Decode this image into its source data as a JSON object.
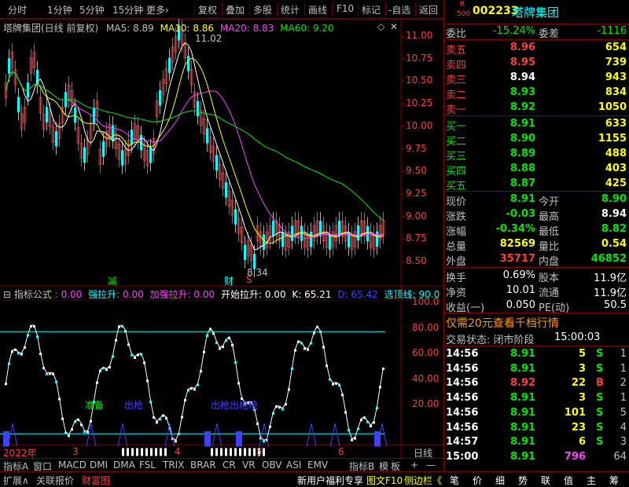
{
  "toolbar": {
    "items": [
      "分时",
      "1分钟",
      "5分钟",
      "15分钟",
      "更多›",
      "复权",
      "叠加",
      "多股",
      "统计",
      "画线",
      "F10",
      "标记",
      "-自选",
      "返回"
    ]
  },
  "chart_header": {
    "name": "塔牌集团(日线 前复权)",
    "ma5": "MA5: 8.89",
    "ma10": "MA10: 8.86",
    "ma20": "MA20: 8.83",
    "ma60": "MA60: 9.20"
  },
  "price_axis": [
    "11.00",
    "10.75",
    "10.50",
    "10.25",
    "10.00",
    "9.75",
    "9.50",
    "9.25",
    "9.00",
    "8.75",
    "8.50"
  ],
  "price_marks": {
    "high": "11.02",
    "low": "8.34",
    "jian": "减",
    "cai": "财",
    "s": "S"
  },
  "indicator_header": {
    "name": "指标公式",
    "v1": ": 0.00",
    "l2": "强拉升",
    "v2": ": 0.00",
    "l3": "加强拉升",
    "v3": ": 0.00",
    "l4": "开始拉升",
    "v4": ": 0.00",
    "l5": "K",
    "v5": ": 65.21",
    "l6": "D",
    "v6": ": 65.42",
    "l7": "选顶线",
    "v7": ": 90.0"
  },
  "ind_axis": [
    "100.0",
    "80.00",
    "60.00",
    "40.00",
    "20.00"
  ],
  "ind_labels": {
    "a": "准备",
    "b": "出枪",
    "c": "出枪出枪枪"
  },
  "date_axis": {
    "y": "2022年",
    "m3": "3",
    "m4": "4",
    "m5": "5",
    "m6": "6",
    "right": "日线"
  },
  "tabs": [
    "指标A",
    "窗口",
    "MACD",
    "DMI",
    "DMA",
    "FSL",
    "TRIX",
    "BRAR",
    "CR",
    "VR",
    "OBV",
    "ASI",
    "EMV",
    "指标B",
    "模",
    "板",
    "+",
    "—"
  ],
  "quote": {
    "code": "002233",
    "name": "塔牌集团",
    "badge_r": "R",
    "badge_n": "500",
    "weibi_l": "委比",
    "weibi": "-15.24%",
    "weicha_l": "委差",
    "weicha": "-1116",
    "asks": [
      {
        "l": "卖五",
        "p": "8.96",
        "v": "654"
      },
      {
        "l": "卖四",
        "p": "8.95",
        "v": "739"
      },
      {
        "l": "卖三",
        "p": "8.94",
        "v": "943"
      },
      {
        "l": "卖二",
        "p": "8.93",
        "v": "834"
      },
      {
        "l": "卖一",
        "p": "8.92",
        "v": "1050"
      }
    ],
    "bids": [
      {
        "l": "买一",
        "p": "8.91",
        "v": "633"
      },
      {
        "l": "买二",
        "p": "8.90",
        "v": "1155"
      },
      {
        "l": "买三",
        "p": "8.89",
        "v": "488"
      },
      {
        "l": "买四",
        "p": "8.88",
        "v": "403"
      },
      {
        "l": "买五",
        "p": "8.87",
        "v": "425"
      }
    ],
    "stats": [
      {
        "l1": "现价",
        "v1": "8.91",
        "l2": "今开",
        "v2": "8.90"
      },
      {
        "l1": "涨跌",
        "v1": "-0.03",
        "l2": "最高",
        "v2": "8.94"
      },
      {
        "l1": "涨幅",
        "v1": "-0.34%",
        "l2": "最低",
        "v2": "8.82"
      },
      {
        "l1": "总量",
        "v1": "82569",
        "l2": "量比",
        "v2": "0.54"
      },
      {
        "l1": "外盘",
        "v1": "35717",
        "l2": "内盘",
        "v2": "46852"
      }
    ],
    "fund": [
      {
        "l1": "换手",
        "v1": "0.69%",
        "l2": "股本",
        "v2": "11.9亿"
      },
      {
        "l1": "净资",
        "v1": "10.01",
        "l2": "流通",
        "v2": "11.9亿"
      },
      {
        "l1": "收益(一)",
        "v1": "0.050",
        "l2": "PE(动)",
        "v2": "50.5"
      }
    ],
    "promo": "仅需20元查看千档行情",
    "status_l": "交易状态: 闭市阶段",
    "status_t": "15:00:03",
    "ticks": [
      {
        "t": "14:56",
        "p": "8.91",
        "v": "5",
        "d": "S",
        "n": "1"
      },
      {
        "t": "14:56",
        "p": "8.91",
        "v": "3",
        "d": "S",
        "n": "1"
      },
      {
        "t": "14:56",
        "p": "8.92",
        "v": "22",
        "d": "B",
        "n": "2"
      },
      {
        "t": "14:56",
        "p": "8.91",
        "v": "3",
        "d": "S",
        "n": "1"
      },
      {
        "t": "14:56",
        "p": "8.91",
        "v": "101",
        "d": "S",
        "n": "5"
      },
      {
        "t": "14:56",
        "p": "8.91",
        "v": "23",
        "d": "S",
        "n": "4"
      },
      {
        "t": "14:57",
        "p": "8.91",
        "v": "6",
        "d": "S",
        "n": "3"
      },
      {
        "t": "15:00",
        "p": "8.91",
        "v": "796",
        "d": "",
        "n": "64"
      }
    ]
  },
  "bottombar": {
    "a": "扩展∧",
    "b": "关联报价",
    "c": "财富图",
    "d": "新用户福利专享",
    "e": "图文F10",
    "f": "侧边栏《",
    "g": [
      "笔",
      "价",
      "细",
      "势",
      "联",
      "值",
      "主",
      "筹"
    ]
  }
}
